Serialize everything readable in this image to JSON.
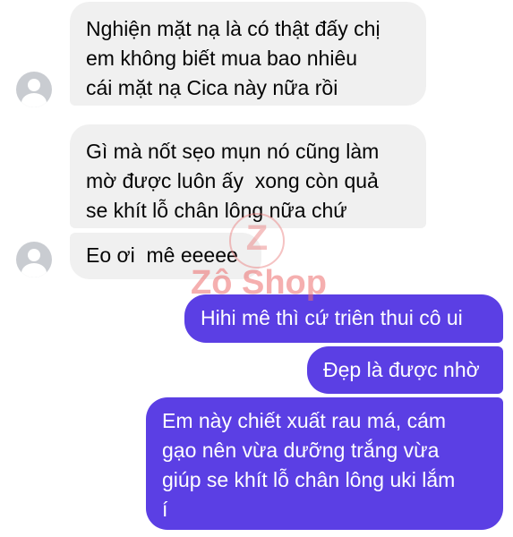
{
  "messages": [
    {
      "sender": "other",
      "text": "Nghiện mặt nạ là có thật đấy chị\nem không biết mua bao nhiêu\ncái mặt nạ Cica này nữa rồi"
    },
    {
      "sender": "other",
      "text": "Gì mà nốt sẹo mụn nó cũng làm\nmờ được luôn ấy  xong còn quả\nse khít lỗ chân lông nữa chứ"
    },
    {
      "sender": "other",
      "text": "Eo ơi  mê eeeee"
    },
    {
      "sender": "me",
      "text": "Hihi mê thì cứ triên thui cô ui"
    },
    {
      "sender": "me",
      "text": "Đẹp là được nhờ"
    },
    {
      "sender": "me",
      "text": "Em này chiết xuất rau má, cám\ngạo nên vừa dưỡng trắng vừa\ngiúp se khít lỗ chân lông uki lắm\ní"
    }
  ],
  "watermark": {
    "logo_letter": "Z",
    "text": "Zô Shop"
  },
  "colors": {
    "incoming_bubble": "#f0f0f0",
    "outgoing_bubble": "#5b3fe4",
    "avatar": "#c9ccd1"
  },
  "icons": {
    "avatar": "default-profile-icon"
  }
}
